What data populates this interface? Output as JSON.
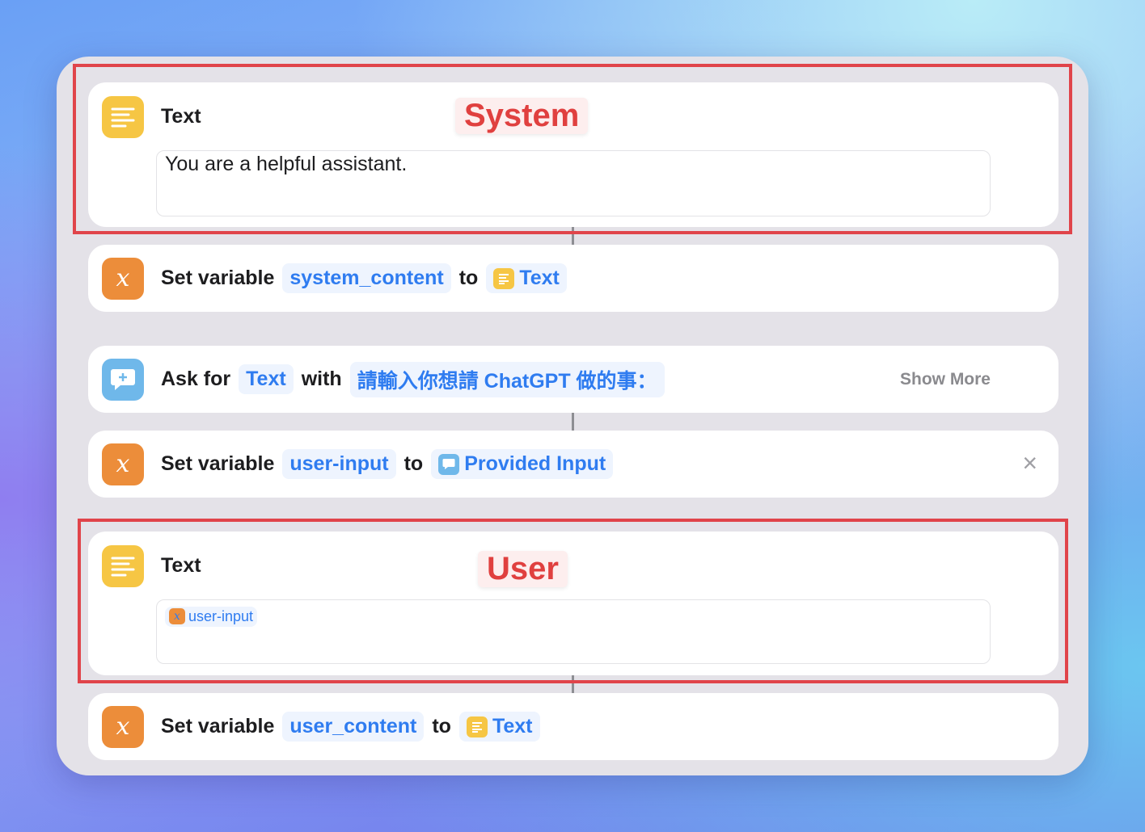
{
  "actions": [
    {
      "type": "text",
      "title": "Text",
      "content": "You are a helpful assistant.",
      "annotation": "System"
    },
    {
      "type": "set_variable",
      "prefix": "Set variable",
      "variable": "system_content",
      "to": "to",
      "value": "Text",
      "value_icon": "text-icon"
    },
    {
      "type": "ask_for",
      "prefix": "Ask for",
      "input_type": "Text",
      "with": "with",
      "prompt": "請輸入你想請 ChatGPT 做的事：",
      "show_more": "Show More"
    },
    {
      "type": "set_variable",
      "prefix": "Set variable",
      "variable": "user-input",
      "to": "to",
      "value": "Provided Input",
      "value_icon": "ask-icon",
      "close": "×"
    },
    {
      "type": "text",
      "title": "Text",
      "content_token": "user-input",
      "annotation": "User"
    },
    {
      "type": "set_variable",
      "prefix": "Set variable",
      "variable": "user_content",
      "to": "to",
      "value": "Text",
      "value_icon": "text-icon"
    }
  ],
  "colors": {
    "text_icon": "#f6c644",
    "variable_icon": "#ec8d3a",
    "ask_icon": "#6fb8ea",
    "token": "#2f7cf0",
    "annotation": "#e0403f"
  }
}
